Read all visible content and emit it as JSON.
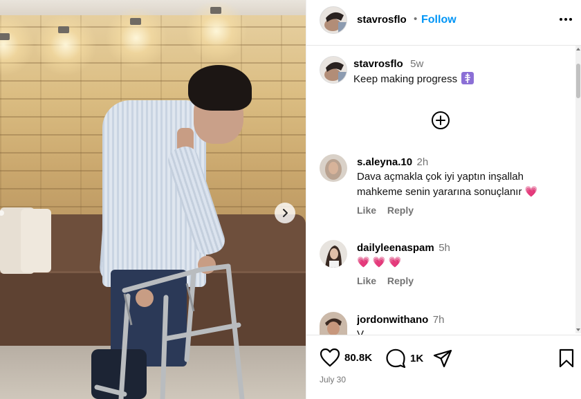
{
  "post": {
    "author": "stavrosflo",
    "follow_label": "Follow",
    "more_icon": "more-horizontal-icon",
    "caption": {
      "username": "stavrosflo",
      "time": "5w",
      "text": "Keep making progress",
      "emoji": "☦️"
    },
    "load_more_icon": "plus-circle-icon"
  },
  "comments": [
    {
      "username": "s.aleyna.10",
      "time": "2h",
      "text": "Dava açmakla çok iyi yaptın inşallah mahkeme senin yararına sonuçlanır 💗",
      "like": "Like",
      "reply": "Reply"
    },
    {
      "username": "dailyleenaspam",
      "time": "5h",
      "text": "💗 💗 💗",
      "like": "Like",
      "reply": "Reply"
    },
    {
      "username": "jordonwithano",
      "time": "7h",
      "text": "V"
    }
  ],
  "actions": {
    "likes": "80.8K",
    "comments": "1K",
    "date": "July 30"
  }
}
